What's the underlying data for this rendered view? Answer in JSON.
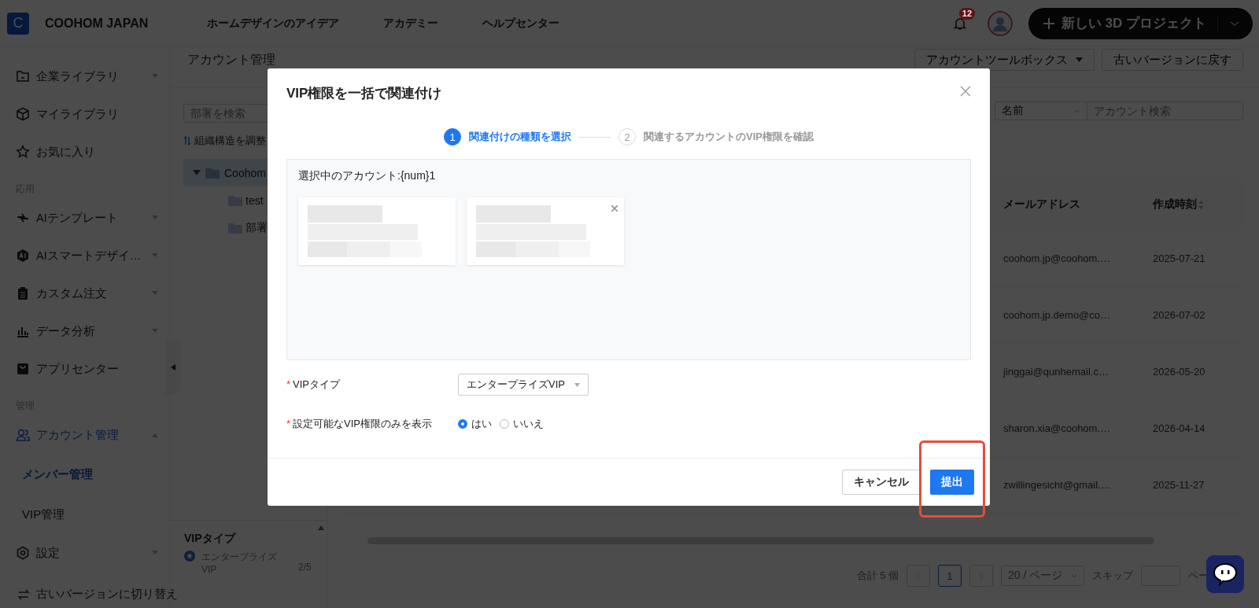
{
  "header": {
    "logo_letter": "C",
    "brand": "COOHOM JAPAN",
    "nav": [
      "ホームデザインのアイデア",
      "アカデミー",
      "ヘルプセンター"
    ],
    "notification_count": "12",
    "new_project_button": "新しい 3D プロジェクト"
  },
  "sidebar": {
    "groups": [
      {
        "items": [
          {
            "label": "企業ライブラリ",
            "expanded": false,
            "selected": false
          },
          {
            "label": "マイライブラリ",
            "selected": false
          },
          {
            "label": "お気に入り",
            "selected": false
          }
        ]
      },
      {
        "heading": "応用",
        "items": [
          {
            "label": "AIテンプレート",
            "expanded": false,
            "selected": false
          },
          {
            "label": "AIスマートデザイ…",
            "expanded": false,
            "selected": false
          },
          {
            "label": "カスタム注文",
            "expanded": false,
            "selected": false
          },
          {
            "label": "データ分析",
            "expanded": false,
            "selected": false
          },
          {
            "label": "アプリセンター",
            "selected": false
          }
        ]
      },
      {
        "heading": "管理",
        "items": [
          {
            "label": "アカウント管理",
            "expanded": true,
            "selected": false,
            "children": [
              {
                "label": "メンバー管理",
                "selected": true
              },
              {
                "label": "VIP管理",
                "selected": false
              }
            ]
          },
          {
            "label": "設定",
            "expanded": false,
            "selected": false
          }
        ]
      }
    ],
    "footer": "古いバージョンに切り替え"
  },
  "page": {
    "title": "アカウント管理",
    "toolbox_button": "アカウントツールボックス",
    "revert_button": "古いバージョンに戻す"
  },
  "departments": {
    "search_placeholder": "部署を検索",
    "adjust_link": "組織構造を調整",
    "tree": [
      {
        "label": "Coohom",
        "expanded": true,
        "selected": true,
        "children": [
          {
            "label": "test",
            "selected": false
          },
          {
            "label": "部署",
            "selected": false
          }
        ]
      }
    ],
    "vip_panel": {
      "title": "VIPタイプ",
      "items": [
        {
          "label": "エンタープライズVIP",
          "count": "2/5"
        }
      ]
    }
  },
  "filter": {
    "field": "名前",
    "search_placeholder": "アカウント検索"
  },
  "table": {
    "columns": [
      {
        "label": "メールアドレス",
        "sortable": false
      },
      {
        "label": "作成時刻",
        "sortable": true
      }
    ],
    "rows": [
      [
        "coohom.jp@coohom.…",
        "2025-07-21"
      ],
      [
        "coohom.jp.demo@co…",
        "2026-07-02"
      ],
      [
        "jinggai@qunhemail.c…",
        "2026-05-20"
      ],
      [
        "sharon.xia@coohom.…",
        "2026-04-14"
      ],
      [
        "zwillingesicht@gmail.…",
        "2025-11-27"
      ]
    ]
  },
  "pagination": {
    "total": "合計 5 個",
    "pages": [
      {
        "label": "1",
        "selected": true
      }
    ],
    "page_size": "20 / ページ",
    "jump_label": "スキップ",
    "jump_suffix": "ペー"
  },
  "dialog": {
    "title": "VIP権限を一括で関連付け",
    "steps": [
      {
        "number": "1",
        "label": "関連付けの種類を選択",
        "selected": true
      },
      {
        "number": "2",
        "label": "関連するアカウントのVIP権限を確認",
        "selected": false
      }
    ],
    "selected_label": "選択中のアカウント:{num}1",
    "account_cards": [
      {
        "kind": "picture",
        "removable": false
      },
      {
        "kind": "picture",
        "removable": true
      }
    ],
    "fields": [
      {
        "kind": "select",
        "label": "VIPタイプ",
        "required": true,
        "required_mark": "*",
        "value": "エンタープライズVIP"
      },
      {
        "kind": "radio",
        "label": "設定可能なVIP権限のみを表示",
        "required": true,
        "required_mark": "*",
        "options": [
          {
            "label": "はい",
            "selected": true
          },
          {
            "label": "いいえ",
            "selected": false
          }
        ]
      }
    ],
    "cancel_button": "キャンセル",
    "submit_button": "提出",
    "submit_highlighted": true
  }
}
